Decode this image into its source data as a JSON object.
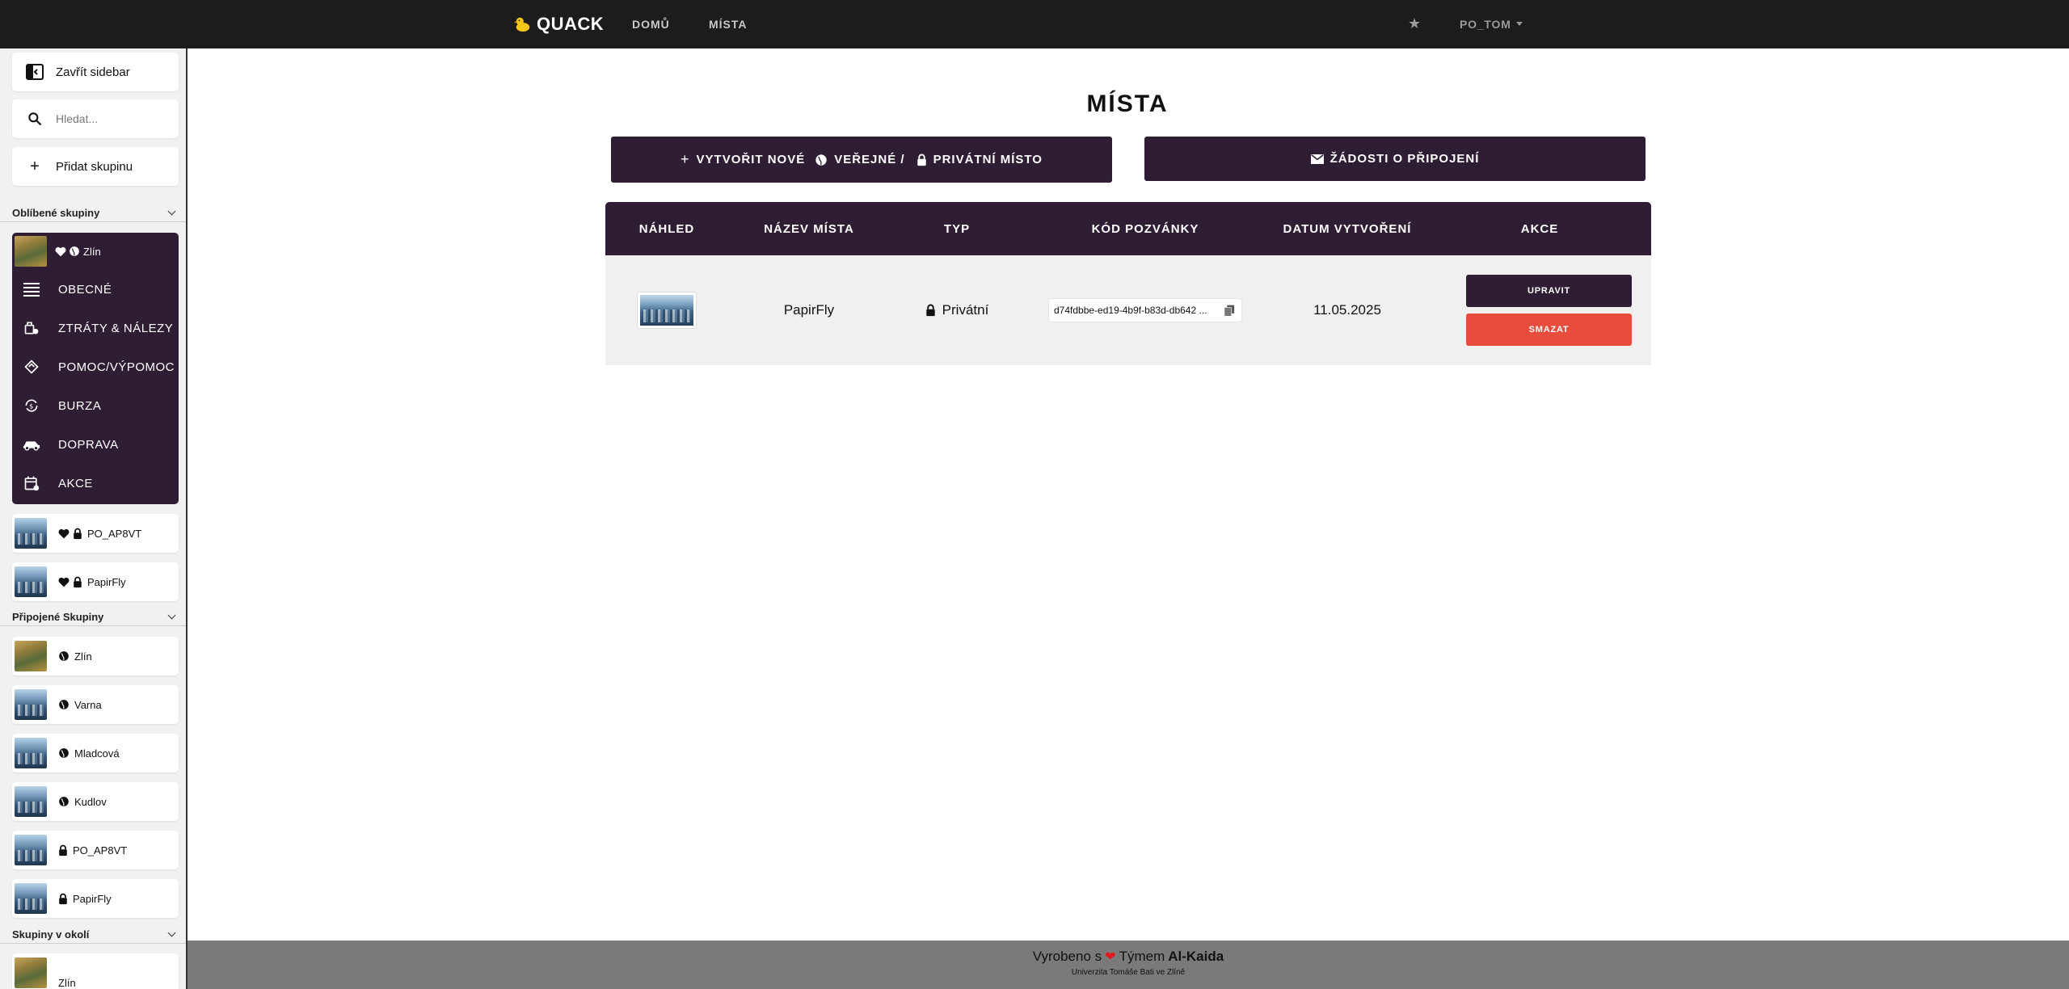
{
  "navbar": {
    "brand": "QUACK",
    "links": [
      "DOMŮ",
      "MÍSTA"
    ],
    "user": "PO_TOM"
  },
  "sidebar": {
    "close_label": "Zavřít sidebar",
    "search_placeholder": "Hledat...",
    "add_group_label": "Přidat skupinu",
    "favorites_title": "Oblíbené skupiny",
    "favorite_open": {
      "name": "Zlín",
      "items": [
        "OBECNÉ",
        "ZTRÁTY & NÁLEZY",
        "POMOC/VÝPOMOC",
        "BURZA",
        "DOPRAVA",
        "AKCE"
      ]
    },
    "favorites_more": [
      "PO_AP8VT",
      "PapirFly"
    ],
    "joined_title": "Připojené Skupiny",
    "joined": [
      "Zlín",
      "Varna",
      "Mladcová",
      "Kudlov",
      "PO_AP8VT",
      "PapirFly"
    ],
    "nearby_title": "Skupiny v okolí",
    "nearby": [
      "Zlín"
    ]
  },
  "main": {
    "title": "MÍSTA",
    "create_button": {
      "part1": "VYTVOŘIT NOVÉ",
      "part2": "VEŘEJNÉ /",
      "part3": "PRIVÁTNÍ MÍSTO"
    },
    "requests_button": "ŽÁDOSTI O PŘIPOJENÍ",
    "table": {
      "headers": [
        "NÁHLED",
        "NÁZEV MÍSTA",
        "TYP",
        "KÓD POZVÁNKY",
        "DATUM VYTVOŘENÍ",
        "AKCE"
      ],
      "rows": [
        {
          "name": "PapirFly",
          "type": "Privátní",
          "invite_code": "d74fdbbe-ed19-4b9f-b83d-db642 ...",
          "created": "11.05.2025",
          "edit_label": "UPRAVIT",
          "delete_label": "SMAZAT"
        }
      ]
    }
  },
  "footer": {
    "made_prefix": "Vyrobeno s",
    "made_suffix": "Týmem",
    "team": "Al-Kaida",
    "university": "Univerzita Tomáše Bati ve Zlíně"
  },
  "colors": {
    "primary": "#2f1d33",
    "danger": "#e74c3c",
    "navbar": "#1c1c1c",
    "footer": "#7a7a7a"
  }
}
